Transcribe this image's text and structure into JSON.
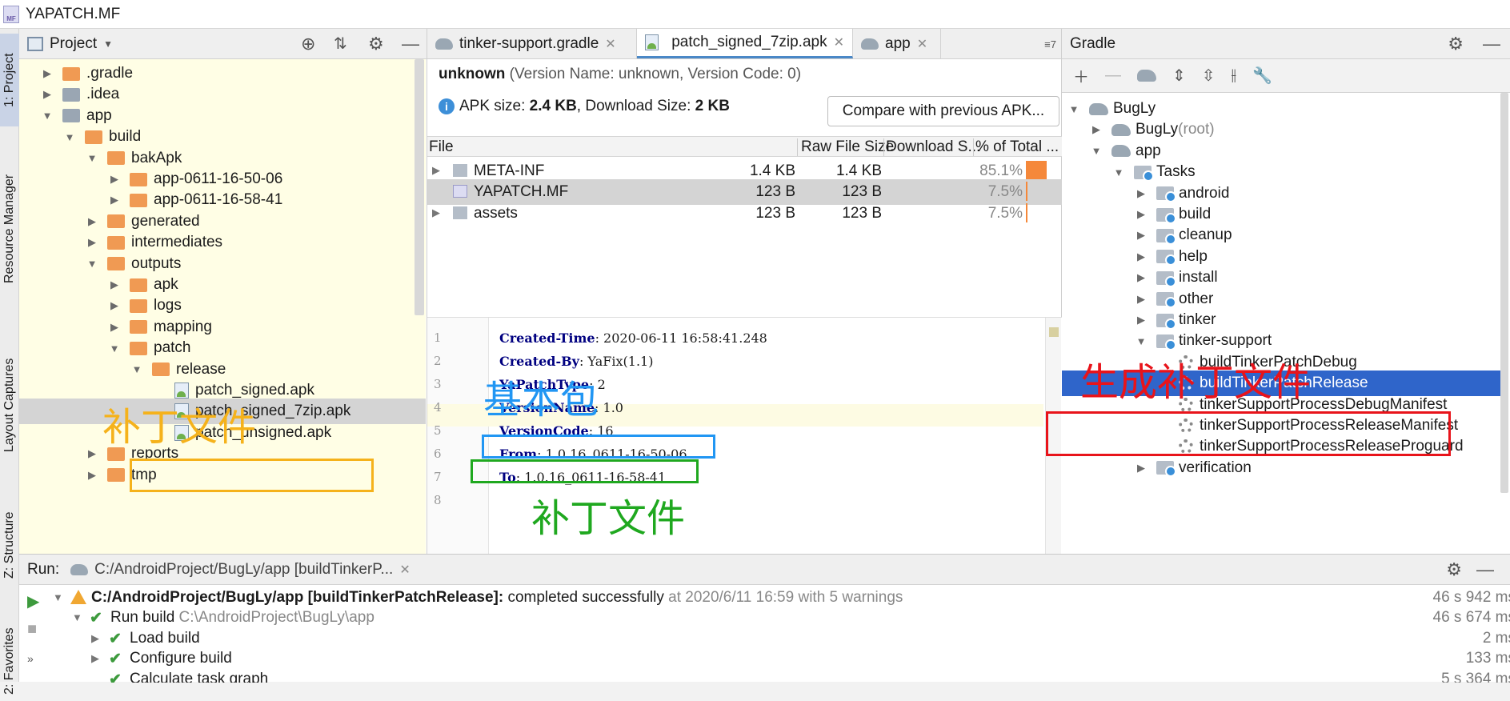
{
  "window": {
    "title": "YAPATCH.MF",
    "title_icon": "MF"
  },
  "left_strip": {
    "tabs": [
      "1: Project",
      "Resource Manager",
      "Layout Captures",
      "Z: Structure",
      "2: Favorites"
    ]
  },
  "project_panel": {
    "title": "Project",
    "tree": [
      {
        "label": ".gradle",
        "indent": 0,
        "arrow": "▶",
        "icon": "folder"
      },
      {
        "label": ".idea",
        "indent": 0,
        "arrow": "▶",
        "icon": "folder-grey"
      },
      {
        "label": "app",
        "indent": 0,
        "arrow": "▼",
        "icon": "folder-grey"
      },
      {
        "label": "build",
        "indent": 1,
        "arrow": "▼",
        "icon": "folder"
      },
      {
        "label": "bakApk",
        "indent": 2,
        "arrow": "▼",
        "icon": "folder"
      },
      {
        "label": "app-0611-16-50-06",
        "indent": 3,
        "arrow": "▶",
        "icon": "folder"
      },
      {
        "label": "app-0611-16-58-41",
        "indent": 3,
        "arrow": "▶",
        "icon": "folder"
      },
      {
        "label": "generated",
        "indent": 2,
        "arrow": "▶",
        "icon": "folder"
      },
      {
        "label": "intermediates",
        "indent": 2,
        "arrow": "▶",
        "icon": "folder"
      },
      {
        "label": "outputs",
        "indent": 2,
        "arrow": "▼",
        "icon": "folder"
      },
      {
        "label": "apk",
        "indent": 3,
        "arrow": "▶",
        "icon": "folder"
      },
      {
        "label": "logs",
        "indent": 3,
        "arrow": "▶",
        "icon": "folder"
      },
      {
        "label": "mapping",
        "indent": 3,
        "arrow": "▶",
        "icon": "folder"
      },
      {
        "label": "patch",
        "indent": 3,
        "arrow": "▼",
        "icon": "folder"
      },
      {
        "label": "release",
        "indent": 4,
        "arrow": "▼",
        "icon": "folder"
      },
      {
        "label": "patch_signed.apk",
        "indent": 5,
        "arrow": "",
        "icon": "apk"
      },
      {
        "label": "patch_signed_7zip.apk",
        "indent": 5,
        "arrow": "",
        "icon": "apk",
        "selected": true
      },
      {
        "label": "patch_unsigned.apk",
        "indent": 5,
        "arrow": "",
        "icon": "apk"
      },
      {
        "label": "reports",
        "indent": 2,
        "arrow": "▶",
        "icon": "folder"
      },
      {
        "label": "tmp",
        "indent": 2,
        "arrow": "▶",
        "icon": "folder"
      }
    ]
  },
  "editor": {
    "tabs": [
      {
        "label": "tinker-support.gradle",
        "active": false
      },
      {
        "label": "patch_signed_7zip.apk",
        "active": true
      },
      {
        "label": "app",
        "active": false
      }
    ],
    "tabs_overflow": "≡7",
    "apk_header": {
      "name": "unknown",
      "version_text": "(Version Name: unknown, Version Code: 0)",
      "size_prefix": "APK size: ",
      "apk_size": "2.4 KB",
      "download_prefix": ", Download Size: ",
      "download_size": "2 KB",
      "compare_button": "Compare with previous APK..."
    },
    "file_columns": [
      "File",
      "Raw File Size",
      "Download S...",
      "% of Total ..."
    ],
    "files": [
      {
        "name": "META-INF",
        "raw": "1.4 KB",
        "download": "1.4 KB",
        "percent": "85.1%",
        "fraction": 0.851,
        "expandable": true,
        "icon": "folder"
      },
      {
        "name": "YAPATCH.MF",
        "raw": "123 B",
        "download": "123 B",
        "percent": "7.5%",
        "fraction": 0.075,
        "expandable": false,
        "icon": "mf",
        "selected": true
      },
      {
        "name": "assets",
        "raw": "123 B",
        "download": "123 B",
        "percent": "7.5%",
        "fraction": 0.075,
        "expandable": true,
        "icon": "folder"
      }
    ],
    "code_lines": [
      {
        "num": "1",
        "key": "Created-Time",
        "value": ": 2020-06-11 16:58:41.248"
      },
      {
        "num": "2",
        "key": "Created-By",
        "value": ": YaFix(1.1)"
      },
      {
        "num": "3",
        "key": "YaPatchType",
        "value": ": 2"
      },
      {
        "num": "4",
        "key": "VersionName",
        "value": ": 1.0"
      },
      {
        "num": "5",
        "key": "VersionCode",
        "value": ": 16"
      },
      {
        "num": "6",
        "key": "From",
        "value": ": 1.0.16_0611-16-50-06"
      },
      {
        "num": "7",
        "key": "To",
        "value": ": 1.0.16_0611-16-58-41"
      },
      {
        "num": "8",
        "key": "",
        "value": ""
      }
    ]
  },
  "gradle_panel": {
    "title": "Gradle",
    "tree": [
      {
        "label": "BugLy",
        "indent": 0,
        "arrow": "▼",
        "icon": "elephant"
      },
      {
        "label": "BugLy",
        "suffix": " (root)",
        "indent": 1,
        "arrow": "▶",
        "icon": "elephant"
      },
      {
        "label": "app",
        "indent": 1,
        "arrow": "▼",
        "icon": "elephant"
      },
      {
        "label": "Tasks",
        "indent": 2,
        "arrow": "▼",
        "icon": "taskfolder"
      },
      {
        "label": "android",
        "indent": 3,
        "arrow": "▶",
        "icon": "taskfolder"
      },
      {
        "label": "build",
        "indent": 3,
        "arrow": "▶",
        "icon": "taskfolder"
      },
      {
        "label": "cleanup",
        "indent": 3,
        "arrow": "▶",
        "icon": "taskfolder"
      },
      {
        "label": "help",
        "indent": 3,
        "arrow": "▶",
        "icon": "taskfolder"
      },
      {
        "label": "install",
        "indent": 3,
        "arrow": "▶",
        "icon": "taskfolder"
      },
      {
        "label": "other",
        "indent": 3,
        "arrow": "▶",
        "icon": "taskfolder"
      },
      {
        "label": "tinker",
        "indent": 3,
        "arrow": "▶",
        "icon": "taskfolder"
      },
      {
        "label": "tinker-support",
        "indent": 3,
        "arrow": "▼",
        "icon": "taskfolder"
      },
      {
        "label": "buildTinkerPatchDebug",
        "indent": 4,
        "arrow": "",
        "icon": "gear"
      },
      {
        "label": "buildTinkerPatchRelease",
        "indent": 4,
        "arrow": "",
        "icon": "gear",
        "selected": true
      },
      {
        "label": "tinkerSupportProcessDebugManifest",
        "indent": 4,
        "arrow": "",
        "icon": "gear"
      },
      {
        "label": "tinkerSupportProcessReleaseManifest",
        "indent": 4,
        "arrow": "",
        "icon": "gear"
      },
      {
        "label": "tinkerSupportProcessReleaseProguard",
        "indent": 4,
        "arrow": "",
        "icon": "gear"
      },
      {
        "label": "verification",
        "indent": 3,
        "arrow": "▶",
        "icon": "taskfolder"
      }
    ]
  },
  "run_panel": {
    "label": "Run:",
    "tab": "C:/AndroidProject/BugLy/app [buildTinkerP...",
    "rows": [
      {
        "bold": "C:/AndroidProject/BugLy/app [buildTinkerPatchRelease]:",
        "text": " completed successfully",
        "grey": " at 2020/6/11 16:59  with 5 warnings",
        "time": "46 s 942 ms",
        "icon": "warn",
        "arrow": "▼"
      },
      {
        "bold": "",
        "text": "Run build",
        "grey": " C:\\AndroidProject\\BugLy\\app",
        "time": "46 s 674 ms",
        "icon": "check",
        "arrow": "▼"
      },
      {
        "bold": "",
        "text": "Load build",
        "grey": "",
        "time": "2 ms",
        "icon": "check",
        "arrow": "▶"
      },
      {
        "bold": "",
        "text": "Configure build",
        "grey": "",
        "time": "133 ms",
        "icon": "check",
        "arrow": "▶"
      },
      {
        "bold": "",
        "text": "Calculate task graph",
        "grey": "",
        "time": "5 s 364 ms",
        "icon": "check",
        "arrow": ""
      }
    ]
  },
  "annotations": {
    "patch_file_left": "补丁文件",
    "base_package": "基本包",
    "patch_file_center": "补丁文件",
    "generate_patch": "生成补丁文件",
    "colors": {
      "orange": "#f5b21b",
      "blue": "#2196f3",
      "green": "#1fa81f",
      "red": "#e8141b"
    }
  }
}
